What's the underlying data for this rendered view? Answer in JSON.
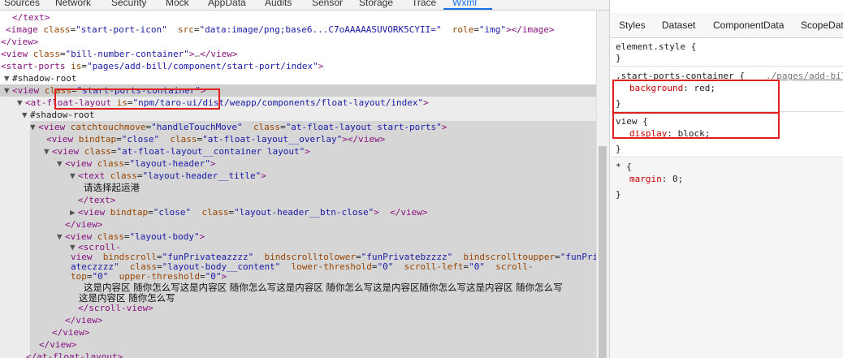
{
  "devtools_tabs": [
    "Sources",
    "Network",
    "Security",
    "Mock",
    "AppData",
    "Audits",
    "Sensor",
    "Storage",
    "Trace",
    "Wxml"
  ],
  "active_tab": "Wxml",
  "tree": {
    "l1": {
      "text": "</text>"
    },
    "l2": {
      "open": "<image ",
      "a1": "class",
      "v1": "\"start-port-icon\"",
      "a2": "src",
      "v2": "\"data:image/png;base6...C7oAAAAASUVORK5CYII=\"",
      "a3": "role",
      "v3": "\"img\"",
      "close": "></image>"
    },
    "l3": {
      "text": "</view>"
    },
    "l4": {
      "open": "<view ",
      "a1": "class",
      "v1": "\"bill-number-container\"",
      "mid": ">",
      "ell": "…",
      "close": "</view>"
    },
    "l5": {
      "open": "<start-ports ",
      "a1": "is",
      "v1": "\"pages/add-bill/component/start-port/index\"",
      "close": ">"
    },
    "l6": {
      "text": "#shadow-root"
    },
    "l7": {
      "open": "<view ",
      "a1": "class",
      "v1": "\"start-ports-container\"",
      "close": ">"
    },
    "l8": {
      "open": "<at-float-layout ",
      "a1": "is",
      "v1": "\"npm/taro-ui/dist/weapp/components/float-layout/index\"",
      "close": ">"
    },
    "l9": {
      "text": "#shadow-root"
    },
    "l10": {
      "open": "<view ",
      "a1": "catchtouchmove",
      "v1": "\"handleTouchMove\"",
      "a2": "class",
      "v2": "\"at-float-layout start-ports\"",
      "close": ">"
    },
    "l11": {
      "open": "<view ",
      "a1": "bindtap",
      "v1": "\"close\"",
      "a2": "class",
      "v2": "\"at-float-layout__overlay\"",
      "close": "></view>"
    },
    "l12": {
      "open": "<view ",
      "a1": "class",
      "v1": "\"at-float-layout__container layout\"",
      "close": ">"
    },
    "l13": {
      "open": "<view ",
      "a1": "class",
      "v1": "\"layout-header\"",
      "close": ">"
    },
    "l14": {
      "open": "<text ",
      "a1": "class",
      "v1": "\"layout-header__title\"",
      "close": ">"
    },
    "l15": {
      "text": "请选择起运港"
    },
    "l16": {
      "text": "</text>"
    },
    "l17": {
      "open": "<view ",
      "a1": "bindtap",
      "v1": "\"close\"",
      "a2": "class",
      "v2": "\"layout-header__btn-close\"",
      "close": ">  </view>"
    },
    "l18": {
      "text": "</view>"
    },
    "l19": {
      "open": "<view ",
      "a1": "class",
      "v1": "\"layout-body\"",
      "close": ">"
    },
    "l20": {
      "text": "<scroll-"
    },
    "l21": {
      "pre": "view ",
      "a1": "bindscroll",
      "v1": "\"funPrivateazzzz\"",
      "a2": "bindscrolltolower",
      "v2": "\"funPrivatebzzzz\"",
      "a3": "bindscrolltoupper",
      "v3": "\"funPriv"
    },
    "l22": {
      "pre": "ateczzzz\" ",
      "a1": "class",
      "v1": "\"layout-body__content\"",
      "a2": "lower-threshold",
      "v2": "\"0\"",
      "a3": "scroll-left",
      "v3": "\"0\"",
      "a4": "scroll-",
      "v4": ""
    },
    "l23": {
      "a1": "top",
      "v1": "\"0\"",
      "a2": "upper-threshold",
      "v2": "\"0\"",
      "close": ">"
    },
    "l24": {
      "text": "这是内容区 随你怎么写这是内容区 随你怎么写这是内容区 随你怎么写这是内容区随你怎么写这是内容区 随你怎么写"
    },
    "l25": {
      "text": "这是内容区 随你怎么写"
    },
    "l26": {
      "text": "</scroll-view>"
    },
    "l27": {
      "text": "</view>"
    },
    "l28": {
      "text": "</view>"
    },
    "l29": {
      "text": "</view>"
    },
    "l30": {
      "text": "</at-float-layout>"
    }
  },
  "styles_pane": {
    "tabs": [
      "Styles",
      "Dataset",
      "ComponentData",
      "ScopeData"
    ],
    "active": "Styles",
    "element_style": "element.style {",
    "close_brace": "}",
    "rule1_selector": ".start-ports-container {",
    "rule1_source": "./pages/add-bill",
    "rule1_prop": "background",
    "rule1_val": "red;",
    "rule2_selector": "view {",
    "rule2_prop": "display",
    "rule2_val": "block;",
    "rule3_selector": "* {",
    "rule3_prop": "margin",
    "rule3_val": "0;"
  },
  "colors": {
    "highlight_box": "#e01f1f",
    "tag": "#881280",
    "attr": "#994500",
    "value": "#1a1aa6",
    "active_tab": "#1a73e8"
  }
}
